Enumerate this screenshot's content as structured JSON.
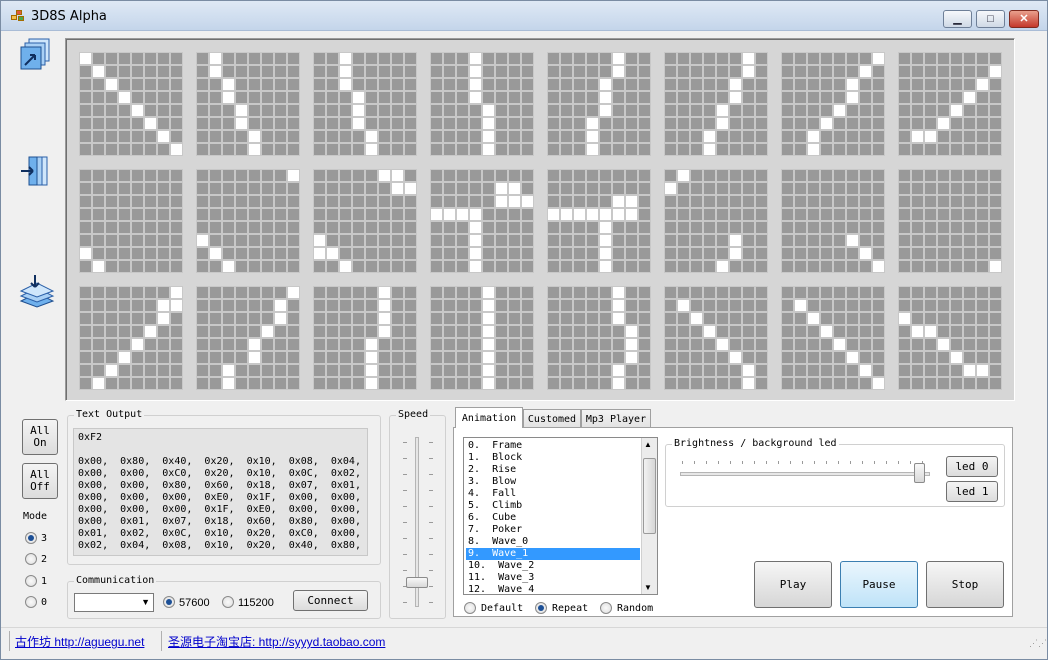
{
  "window": {
    "title": "3D8S Alpha",
    "minimize": "▁",
    "maximize": "□",
    "close": "✕"
  },
  "tools": [
    {
      "name": "layers-export-icon"
    },
    {
      "name": "layers-import-icon"
    },
    {
      "name": "layers-stack-icon"
    }
  ],
  "matrix": {
    "rows": [
      [
        [
          "10000000",
          "01000000",
          "00100000",
          "00010000",
          "00001000",
          "00000100",
          "00000010",
          "00000001"
        ],
        [
          "01000000",
          "01000000",
          "00100000",
          "00100000",
          "00010000",
          "00010000",
          "00001000",
          "00001000"
        ],
        [
          "00100000",
          "00100000",
          "00100000",
          "00010000",
          "00010000",
          "00010000",
          "00001000",
          "00001000"
        ],
        [
          "00010000",
          "00010000",
          "00010000",
          "00010000",
          "00001000",
          "00001000",
          "00001000",
          "00001000"
        ],
        [
          "00000100",
          "00000100",
          "00001000",
          "00001000",
          "00001000",
          "00010000",
          "00010000",
          "00010000"
        ],
        [
          "00000010",
          "00000010",
          "00000100",
          "00000100",
          "00001000",
          "00001000",
          "00010000",
          "00010000"
        ],
        [
          "00000001",
          "00000010",
          "00000100",
          "00000100",
          "00001000",
          "00010000",
          "00100000",
          "00100000"
        ],
        [
          "00000000",
          "00000001",
          "00000010",
          "00000100",
          "00001000",
          "00010000",
          "01100000",
          "00000000"
        ]
      ],
      [
        [
          "00000000",
          "00000000",
          "00000000",
          "00000000",
          "00000000",
          "00000000",
          "10000000",
          "01000000"
        ],
        [
          "00000001",
          "00000000",
          "00000000",
          "00000000",
          "00000000",
          "10000000",
          "01000000",
          "00100000"
        ],
        [
          "00000110",
          "00000011",
          "00000000",
          "00000000",
          "00000000",
          "10000000",
          "11000000",
          "00100000"
        ],
        [
          "00000000",
          "00000110",
          "00000111",
          "11110000",
          "00010000",
          "00010000",
          "00010000",
          "00010000"
        ],
        [
          "00000000",
          "00000000",
          "00000110",
          "11111110",
          "00001000",
          "00001000",
          "00001000",
          "00001000"
        ],
        [
          "01000000",
          "10000000",
          "00000000",
          "00000000",
          "00000000",
          "00000100",
          "00000100",
          "00001000"
        ],
        [
          "00000000",
          "00000000",
          "00000000",
          "00000000",
          "00000000",
          "00000100",
          "00000010",
          "00000001"
        ],
        [
          "00000000",
          "00000000",
          "00000000",
          "00000000",
          "00000000",
          "00000000",
          "00000000",
          "00000001"
        ]
      ],
      [
        [
          "00000001",
          "00000011",
          "00000010",
          "00000100",
          "00001000",
          "00010000",
          "00100000",
          "01000000"
        ],
        [
          "00000001",
          "00000010",
          "00000010",
          "00000100",
          "00001000",
          "00001000",
          "00100000",
          "00100000"
        ],
        [
          "00000100",
          "00000100",
          "00000100",
          "00000100",
          "00001000",
          "00001000",
          "00001000",
          "00001000"
        ],
        [
          "00001000",
          "00001000",
          "00001000",
          "00001000",
          "00001000",
          "00001000",
          "00001000",
          "00001000"
        ],
        [
          "00000100",
          "00000100",
          "00000100",
          "00000010",
          "00000010",
          "00000010",
          "00000100",
          "00000100"
        ],
        [
          "00000000",
          "01000000",
          "00100000",
          "00010000",
          "00001000",
          "00000100",
          "00000010",
          "00000010"
        ],
        [
          "00000000",
          "01000000",
          "00100000",
          "00010000",
          "00001000",
          "00000100",
          "00000010",
          "00000001"
        ],
        [
          "00000000",
          "00000000",
          "10000000",
          "01100000",
          "00010000",
          "00001000",
          "00000110",
          "00000000"
        ]
      ]
    ]
  },
  "buttons": {
    "all_on": "All\nOn",
    "all_off": "All\nOff",
    "connect": "Connect",
    "play": "Play",
    "pause": "Pause",
    "stop": "Stop",
    "led0": "led 0",
    "led1": "led 1"
  },
  "mode": {
    "label": "Mode",
    "options": [
      "3",
      "2",
      "1",
      "0"
    ],
    "selected": "3"
  },
  "text_output": {
    "label": "Text Output",
    "content": "0xF2\n\n0x00,  0x80,  0x40,  0x20,  0x10,  0x08,  0x04,  0x02,\n0x00,  0x00,  0xC0,  0x20,  0x10,  0x0C,  0x02,  0x01,\n0x00,  0x00,  0x80,  0x60,  0x18,  0x07,  0x01,  0x00,\n0x00,  0x00,  0x00,  0xE0,  0x1F,  0x00,  0x00,  0x00,\n0x00,  0x00,  0x00,  0x1F,  0xE0,  0x00,  0x00,  0x00,\n0x00,  0x01,  0x07,  0x18,  0x60,  0x80,  0x00,  0x00,\n0x01,  0x02,  0x0C,  0x10,  0x20,  0xC0,  0x00,  0x00,\n0x02,  0x04,  0x08,  0x10,  0x20,  0x40,  0x80,  0x00,"
  },
  "speed": {
    "label": "Speed"
  },
  "communication": {
    "label": "Communication",
    "port": "",
    "baud_57600": "57600",
    "baud_115200": "115200",
    "selected_baud": "57600"
  },
  "tabs": [
    {
      "label": "Animation",
      "active": true
    },
    {
      "label": "Customed",
      "active": false
    },
    {
      "label": "Mp3 Player",
      "active": false
    }
  ],
  "animation_list": {
    "items": [
      "0.  Frame",
      "1.  Block",
      "2.  Rise",
      "3.  Blow",
      "4.  Fall",
      "5.  Climb",
      "6.  Cube",
      "7.  Poker",
      "8.  Wave_0",
      "9.  Wave_1",
      "10.  Wave_2",
      "11.  Wave_3",
      "12.  Wave_4"
    ],
    "selected_index": 9
  },
  "play_mode": {
    "default": "Default",
    "repeat": "Repeat",
    "random": "Random",
    "selected": "Repeat"
  },
  "brightness": {
    "label": "Brightness / background led",
    "level": 0.98
  },
  "status": {
    "link1": "古作坊 http://aguegu.net",
    "link2": "圣源电子淘宝店: http://syyyd.taobao.com"
  },
  "colors": {
    "led_off": "#999999",
    "led_on": "#ffffff",
    "selection": "#3399ff",
    "link": "#0000cc"
  }
}
